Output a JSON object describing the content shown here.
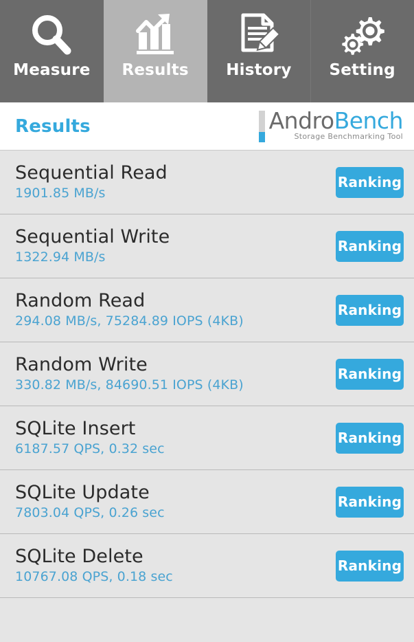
{
  "tabs": [
    {
      "id": "measure",
      "label": "Measure",
      "icon": "magnifier-icon",
      "active": false
    },
    {
      "id": "results",
      "label": "Results",
      "icon": "bar-chart-arrow-icon",
      "active": true
    },
    {
      "id": "history",
      "label": "History",
      "icon": "document-pencil-icon",
      "active": false
    },
    {
      "id": "setting",
      "label": "Setting",
      "icon": "gears-icon",
      "active": false
    }
  ],
  "header": {
    "title": "Results",
    "logo": {
      "word_primary": "Andro",
      "word_secondary": "Bench",
      "tagline": "Storage Benchmarking Tool"
    }
  },
  "results": [
    {
      "title": "Sequential Read",
      "value": "1901.85 MB/s",
      "button": "Ranking"
    },
    {
      "title": "Sequential Write",
      "value": "1322.94 MB/s",
      "button": "Ranking"
    },
    {
      "title": "Random Read",
      "value": "294.08 MB/s, 75284.89 IOPS (4KB)",
      "button": "Ranking"
    },
    {
      "title": "Random Write",
      "value": "330.82 MB/s, 84690.51 IOPS (4KB)",
      "button": "Ranking"
    },
    {
      "title": "SQLite Insert",
      "value": "6187.57 QPS, 0.32 sec",
      "button": "Ranking"
    },
    {
      "title": "SQLite Update",
      "value": "7803.04 QPS, 0.26 sec",
      "button": "Ranking"
    },
    {
      "title": "SQLite Delete",
      "value": "10767.08 QPS, 0.18 sec",
      "button": "Ranking"
    }
  ],
  "colors": {
    "accent_blue": "#35a9dd",
    "value_blue": "#4aa3d1",
    "tab_inactive": "#6b6b6b",
    "tab_active": "#b4b4b4",
    "list_background": "#e5e5e5"
  }
}
